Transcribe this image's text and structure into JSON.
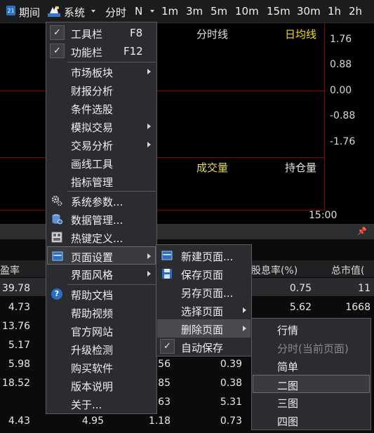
{
  "toolbar": {
    "period_label": "期间",
    "system_label": "系统",
    "timeshare_label": "分时",
    "n_label": "N",
    "intervals": [
      "1m",
      "3m",
      "5m",
      "10m",
      "15m",
      "30m",
      "1h",
      "2h"
    ]
  },
  "chart": {
    "price_title": "分时线",
    "avg_title": "日均线",
    "y_ticks": [
      "1.76",
      "0.88",
      "0.00",
      "-0.88",
      "-1.76"
    ],
    "volume_title": "成交量",
    "oi_title": "持仓量",
    "time_label": "15:00",
    "colors": {
      "grid": "#8b0000",
      "avg": "#f0e000",
      "volume": "#e0d040"
    }
  },
  "panel": {
    "pin_icon": "pin-icon"
  },
  "table": {
    "headers": [
      "盈率",
      "股息率(%)",
      "总市值("
    ],
    "rows": [
      [
        "39.78",
        "",
        "",
        "0.75",
        "11"
      ],
      [
        "4.73",
        "",
        "",
        "5.62",
        "1668"
      ],
      [
        "13.76",
        "",
        "",
        "",
        ""
      ],
      [
        "5.17",
        "",
        "",
        "",
        ""
      ],
      [
        "5.98",
        "",
        ".56",
        "0.39",
        ""
      ],
      [
        "18.52",
        "",
        ".85",
        "0.38",
        ""
      ],
      [
        "",
        "",
        ".63",
        "5.31",
        ""
      ],
      [
        "4.43",
        "4.95",
        "1.18",
        "0.73",
        ""
      ]
    ]
  },
  "system_menu": {
    "items": [
      {
        "label": "工具栏",
        "shortcut": "F8",
        "checked": true
      },
      {
        "label": "功能栏",
        "shortcut": "F12",
        "checked": true
      },
      {
        "label": "市场板块",
        "submenu": true
      },
      {
        "label": "财报分析"
      },
      {
        "label": "条件选股"
      },
      {
        "label": "模拟交易",
        "submenu": true
      },
      {
        "label": "交易分析",
        "submenu": true
      },
      {
        "label": "画线工具"
      },
      {
        "label": "指标管理"
      },
      {
        "label": "系统参数...",
        "icon": "gear-icon"
      },
      {
        "label": "数据管理...",
        "icon": "database-icon"
      },
      {
        "label": "热键定义...",
        "icon": "keyboard-icon"
      },
      {
        "label": "页面设置",
        "icon": "window-icon",
        "submenu": true
      },
      {
        "label": "界面风格",
        "submenu": true
      },
      {
        "label": "帮助文档",
        "icon": "help-icon"
      },
      {
        "label": "帮助视频"
      },
      {
        "label": "官方网站"
      },
      {
        "label": "升级检测"
      },
      {
        "label": "购买软件"
      },
      {
        "label": "版本说明"
      },
      {
        "label": "关于..."
      }
    ]
  },
  "page_menu": {
    "items": [
      {
        "label": "新建页面...",
        "icon": "new-page-icon"
      },
      {
        "label": "保存页面",
        "icon": "save-icon"
      },
      {
        "label": "另存页面..."
      },
      {
        "label": "选择页面",
        "submenu": true
      },
      {
        "label": "删除页面",
        "submenu": true
      },
      {
        "label": "自动保存",
        "checked": true
      }
    ]
  },
  "delete_menu": {
    "items": [
      {
        "label": "行情"
      },
      {
        "label": "分时(当前页面)",
        "disabled": true
      },
      {
        "label": "简单"
      },
      {
        "label": "二图",
        "selected": true
      },
      {
        "label": "三图"
      },
      {
        "label": "四图"
      }
    ]
  }
}
